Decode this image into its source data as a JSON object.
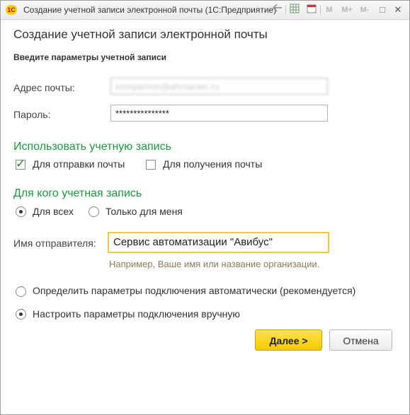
{
  "window": {
    "app_icon_text": "1С",
    "title": "Создание учетной записи электронной почты  (1С:Предприятие)",
    "toolbar": {
      "m_label": "M",
      "m_plus_label": "M+",
      "m_minus_label": "M-",
      "close_symbol": "✕",
      "maximize_symbol": "□",
      "calendar_label": "31"
    }
  },
  "form": {
    "title": "Создание учетной записи электронной почты",
    "subheading": "Введите параметры учетной записи",
    "email_label": "Адрес почты:",
    "email_value": "kompanion@ahrsaoen.ru",
    "password_label": "Пароль:",
    "password_value": "***************",
    "use_section": "Использовать учетную запись",
    "use_send_label": "Для отправки почты",
    "use_send_checked": true,
    "use_receive_label": "Для получения почты",
    "use_receive_checked": false,
    "whom_section": "Для кого учетная запись",
    "for_all_label": "Для всех",
    "only_me_label": "Только для меня",
    "sender_label": "Имя отправителя:",
    "sender_value": "Сервис автоматизации \"Авибус\"",
    "sender_hint": "Например, Ваше имя или название организации.",
    "auto_label": "Определить параметры подключения автоматически (рекомендуется)",
    "manual_label": "Настроить параметры подключения вручную",
    "next_button": "Далее >",
    "cancel_button": "Отмена"
  }
}
